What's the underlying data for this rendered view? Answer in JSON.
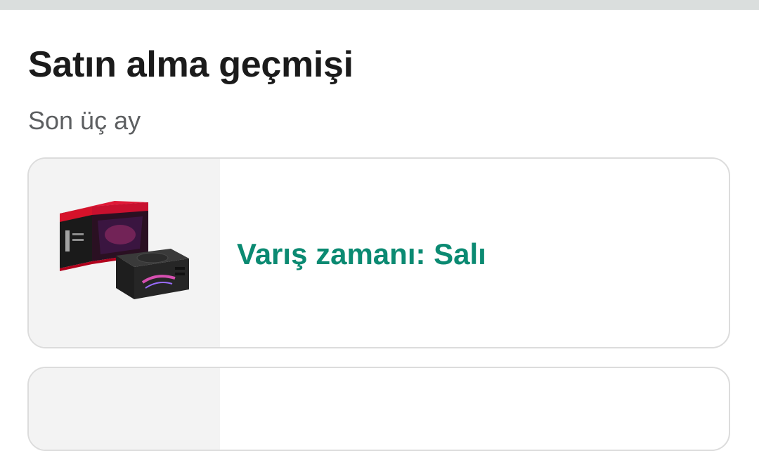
{
  "header": {
    "title": "Satın alma geçmişi",
    "subtitle": "Son üç ay"
  },
  "orders": [
    {
      "product_image": "rog-strix-power-supply-box",
      "status": "Varış zamanı: Salı",
      "status_color": "#0b8a72"
    }
  ],
  "colors": {
    "top_bar": "#dadedd",
    "title": "#1b1b1b",
    "subtitle": "#5d5f61",
    "card_border": "#dcdcdc",
    "thumb_bg": "#f3f3f3"
  }
}
